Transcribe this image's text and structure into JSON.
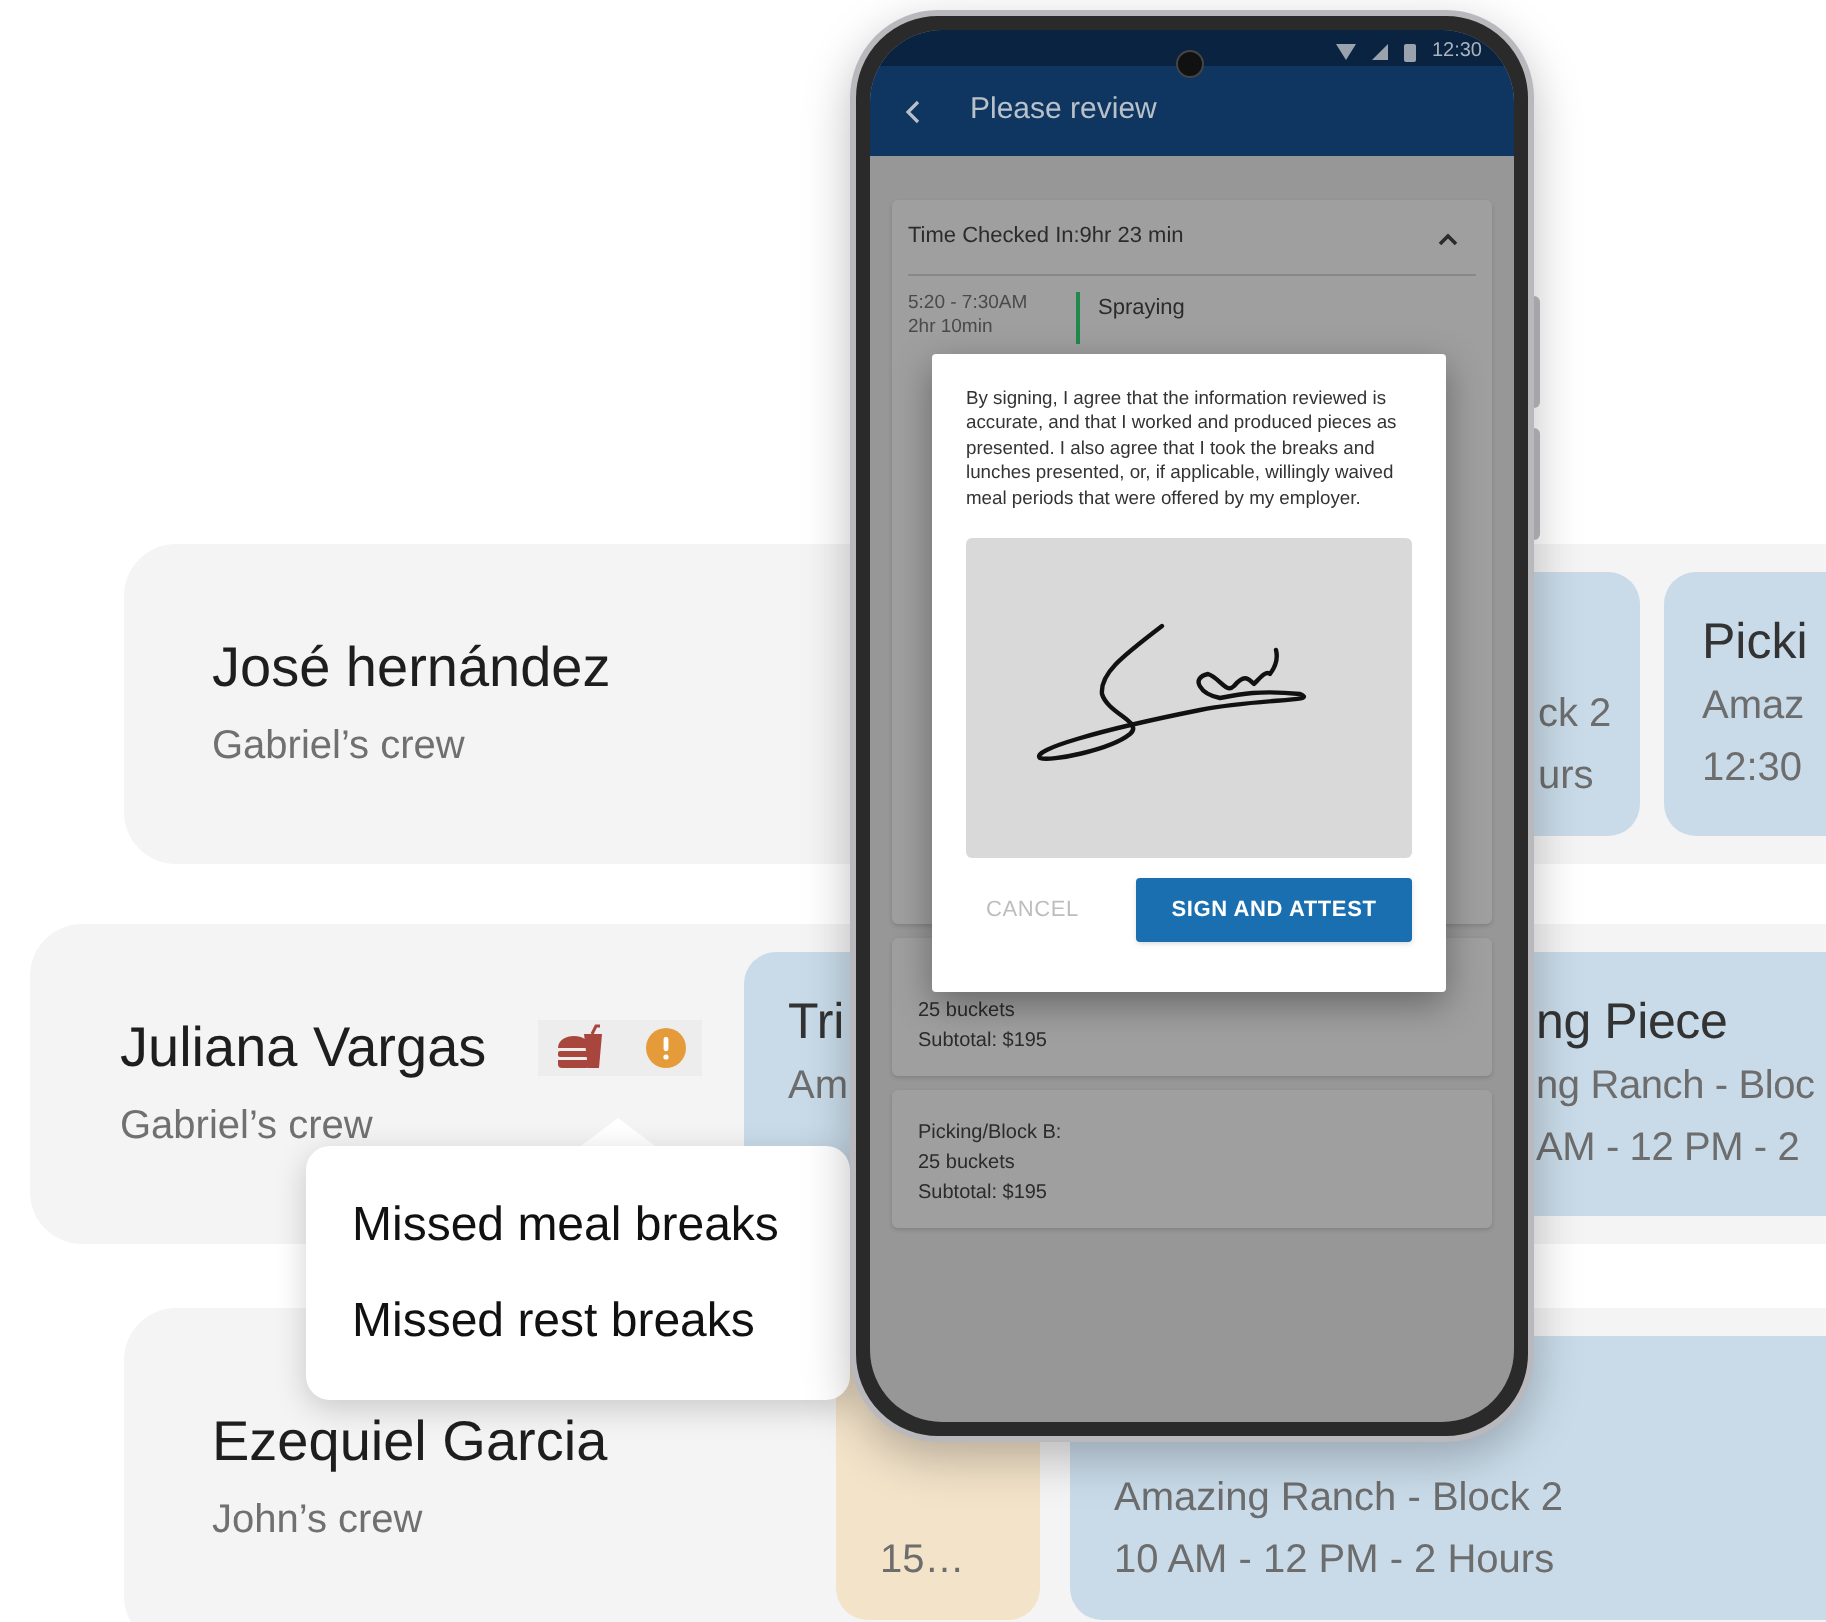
{
  "rows": [
    {
      "name": "José hernández",
      "crew": "Gabriel’s crew",
      "alerts": false,
      "cards": [
        {
          "kind": "task",
          "lines": [
            "ck 2",
            "urs"
          ]
        },
        {
          "kind": "task",
          "title": "Picki",
          "lines": [
            "Amaz",
            "12:30"
          ]
        }
      ]
    },
    {
      "name": "Juliana Vargas",
      "crew": "Gabriel’s crew",
      "alerts": true,
      "cards": [
        {
          "kind": "task",
          "title": "Tri",
          "lines": [
            "Am"
          ]
        },
        {
          "kind": "task",
          "title": "ng Piece",
          "lines": [
            "ng Ranch - Bloc",
            "AM - 12 PM - 2"
          ]
        }
      ]
    },
    {
      "name": "Ezequiel Garcia",
      "crew": "John’s crew",
      "alerts": false,
      "cards": [
        {
          "kind": "break",
          "lines": [
            "15…"
          ]
        },
        {
          "kind": "task",
          "lines": [
            "Amazing Ranch - Block 2",
            "10 AM - 12 PM - 2 Hours"
          ]
        }
      ]
    }
  ],
  "popover": {
    "items": [
      "Missed meal breaks",
      "Missed rest breaks"
    ]
  },
  "phone": {
    "status_time": "12:30",
    "title": "Please review",
    "summary": "Time Checked In:9hr 23 min",
    "expanded": true,
    "entries": [
      {
        "time": "5:20 - 7:30AM",
        "duration": "2hr 10min",
        "task": "Spraying"
      }
    ],
    "pieces": [
      {
        "lines": [
          "25 buckets",
          "Subtotal: $195"
        ]
      },
      {
        "lines": [
          "Picking/Block B:",
          "25 buckets",
          "Subtotal: $195"
        ]
      }
    ],
    "dialog": {
      "text": "By signing, I agree that the information reviewed is accurate, and that I worked and produced pieces as presented. I also agree that I took the breaks and lunches presented, or, if applicable, willingly waived meal periods that were offered by my employer.",
      "buttons": [
        {
          "label": "CANCEL",
          "kind": "text"
        },
        {
          "label": "SIGN AND ATTEST",
          "kind": "primary"
        }
      ]
    }
  }
}
